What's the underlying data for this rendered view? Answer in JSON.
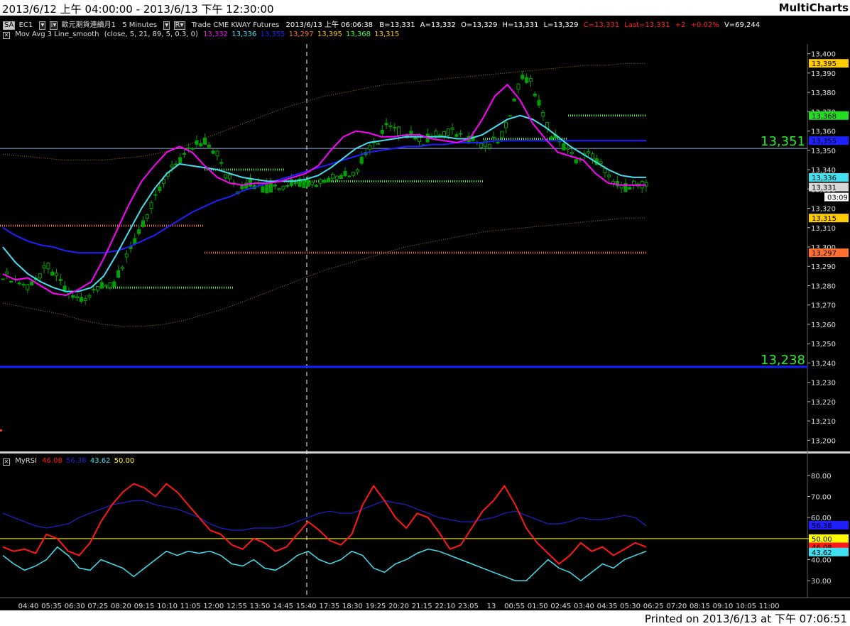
{
  "window": {
    "title": "2013/6/12 上午 04:00:00 - 2013/6/13 下午 12:30:00",
    "brand": "MultiCharts",
    "footer": "Printed on 2013/6/13 at 下午 07:06:51"
  },
  "toolbar": {
    "sa": "SA",
    "symbol": "EC1",
    "name": "歐元期貨連續月1",
    "interval": "5 Minutes",
    "r": "R",
    "desc": "Trade  CME  KWAY  Futures",
    "datetime": "2013/6/13  上午 06:06:38",
    "b": "B=13,331",
    "a": "A=13,332",
    "o": "O=13,329",
    "h": "H=13,331",
    "l": "L=13,329",
    "c": "C=13,331",
    "last": "Last=13,331",
    "chg": "+2",
    "pct": "+0.02%",
    "v": "V=69,244"
  },
  "ma_legend": {
    "name": "Mov Avg 3 Line_smooth",
    "params": "(close, 5, 21, 89, 5, 0.3, 0)",
    "values": [
      "13,332",
      "13,336",
      "13,355",
      "13,297",
      "13,395",
      "13,368",
      "13,315"
    ]
  },
  "rsi_legend": {
    "name": "MyRSI",
    "values": [
      "46.08",
      "56.38",
      "43.62",
      "50.00"
    ]
  },
  "colors": {
    "bg": "#000000",
    "candle": "#00a000",
    "ma_fast": "#ff00ff",
    "ma_mid": "#44e0f0",
    "ma_slow": "#2020ff",
    "level_green": "#44ff44",
    "level_orange": "#ff7030",
    "band": "#a07030",
    "rsi_red": "#ff1818",
    "rsi_blue": "#2020cc",
    "rsi_cyan": "#40e0f0",
    "rsi_mid": "#ffff00"
  },
  "chart_data": [
    {
      "type": "candlestick",
      "instrument": "EC1 歐元期貨連續月1",
      "interval": "5 Minutes",
      "ylim": [
        13195,
        13405
      ],
      "y_ticks": [
        13200,
        13210,
        13220,
        13230,
        13240,
        13250,
        13260,
        13270,
        13280,
        13290,
        13300,
        13310,
        13320,
        13330,
        13340,
        13350,
        13360,
        13370,
        13380,
        13390,
        13400
      ],
      "x_ticks": [
        "04:40",
        "05:35",
        "06:30",
        "07:25",
        "08:20",
        "09:15",
        "10:10",
        "11:05",
        "12:00",
        "12:55",
        "13:50",
        "14:45",
        "15:40",
        "17:35",
        "18:30",
        "19:25",
        "20:20",
        "21:15",
        "22:10",
        "23:05",
        "13",
        "00:55",
        "01:50",
        "02:45",
        "03:40",
        "04:35",
        "05:30",
        "06:25",
        "07:20",
        "08:15",
        "09:10",
        "10:05",
        "11:00"
      ],
      "session_divider": "15:40",
      "close_path": [
        [
          0,
          13286
        ],
        [
          6,
          13280
        ],
        [
          11,
          13290
        ],
        [
          16,
          13275
        ],
        [
          20,
          13272
        ],
        [
          23,
          13280
        ],
        [
          27,
          13282
        ],
        [
          31,
          13298
        ],
        [
          34,
          13312
        ],
        [
          37,
          13325
        ],
        [
          40,
          13338
        ],
        [
          43,
          13345
        ],
        [
          46,
          13352
        ],
        [
          49,
          13355
        ],
        [
          52,
          13348
        ],
        [
          54,
          13338
        ],
        [
          57,
          13330
        ],
        [
          60,
          13333
        ],
        [
          64,
          13330
        ],
        [
          68,
          13332
        ],
        [
          72,
          13333
        ],
        [
          76,
          13333
        ],
        [
          79,
          13336
        ],
        [
          83,
          13338
        ],
        [
          86,
          13340
        ],
        [
          88,
          13348
        ],
        [
          91,
          13355
        ],
        [
          93,
          13362
        ],
        [
          96,
          13360
        ],
        [
          99,
          13358
        ],
        [
          102,
          13355
        ],
        [
          105,
          13358
        ],
        [
          108,
          13360
        ],
        [
          111,
          13358
        ],
        [
          114,
          13355
        ],
        [
          117,
          13353
        ],
        [
          120,
          13355
        ],
        [
          122,
          13362
        ],
        [
          124,
          13378
        ],
        [
          126,
          13388
        ],
        [
          128,
          13385
        ],
        [
          131,
          13368
        ],
        [
          133,
          13358
        ],
        [
          136,
          13352
        ],
        [
          139,
          13345
        ],
        [
          142,
          13348
        ],
        [
          145,
          13343
        ],
        [
          147,
          13335
        ],
        [
          150,
          13330
        ],
        [
          153,
          13333
        ],
        [
          155,
          13332
        ],
        [
          156,
          13331
        ]
      ],
      "series": [
        {
          "name": "MA5",
          "values": [
            13286,
            13283,
            13284,
            13280,
            13276,
            13275,
            13278,
            13282,
            13294,
            13308,
            13322,
            13334,
            13342,
            13349,
            13352,
            13349,
            13342,
            13336,
            13333,
            13332,
            13333,
            13333,
            13334,
            13336,
            13338,
            13342,
            13350,
            13357,
            13360,
            13359,
            13357,
            13357,
            13358,
            13358,
            13356,
            13355,
            13354,
            13356,
            13366,
            13378,
            13384,
            13376,
            13364,
            13356,
            13349,
            13347,
            13345,
            13338,
            13333,
            13332,
            13332,
            13332
          ]
        },
        {
          "name": "MA21",
          "values": [
            13300,
            13292,
            13286,
            13282,
            13279,
            13277,
            13277,
            13279,
            13285,
            13296,
            13308,
            13320,
            13330,
            13338,
            13343,
            13342,
            13341,
            13340,
            13338,
            13336,
            13335,
            13334,
            13334,
            13334,
            13335,
            13337,
            13341,
            13346,
            13351,
            13354,
            13355,
            13356,
            13357,
            13357,
            13357,
            13357,
            13356,
            13356,
            13358,
            13362,
            13366,
            13368,
            13366,
            13362,
            13357,
            13352,
            13348,
            13344,
            13340,
            13337,
            13336,
            13336
          ]
        },
        {
          "name": "MA89",
          "values": [
            13310,
            13306,
            13303,
            13301,
            13300,
            13298,
            13297,
            13297,
            13297,
            13298,
            13300,
            13303,
            13306,
            13310,
            13314,
            13318,
            13321,
            13324,
            13326,
            13329,
            13331,
            13333,
            13335,
            13337,
            13339,
            13341,
            13343,
            13345,
            13347,
            13349,
            13350,
            13351,
            13352,
            13352,
            13353,
            13353,
            13354,
            13354,
            13354,
            13355,
            13355,
            13355,
            13355,
            13355,
            13355,
            13355,
            13355,
            13355,
            13355,
            13355,
            13355,
            13355
          ]
        },
        {
          "name": "Upper band",
          "values": [
            13348,
            13347,
            13346,
            13345,
            13345,
            13345,
            13346,
            13347,
            13349,
            13352,
            13356,
            13360,
            13364,
            13368,
            13372,
            13375,
            13378,
            13380,
            13382,
            13384,
            13385,
            13386,
            13387,
            13388,
            13389,
            13390,
            13391,
            13392,
            13393,
            13394,
            13394,
            13395,
            13395
          ]
        },
        {
          "name": "Lower band",
          "values": [
            13271,
            13269,
            13267,
            13265,
            13262,
            13260,
            13259,
            13259,
            13260,
            13262,
            13265,
            13268,
            13272,
            13276,
            13280,
            13284,
            13288,
            13291,
            13294,
            13297,
            13300,
            13302,
            13304,
            13306,
            13308,
            13309,
            13310,
            13311,
            13312,
            13313,
            13314,
            13315,
            13315
          ]
        }
      ],
      "levels": [
        {
          "value": 13311,
          "color": "green"
        },
        {
          "value": 13311,
          "color": "orange"
        },
        {
          "value": 13340,
          "color": "green"
        },
        {
          "value": 13279,
          "color": "green"
        },
        {
          "value": 13297,
          "color": "orange"
        },
        {
          "value": 13334,
          "color": "green"
        },
        {
          "value": 13368,
          "color": "green"
        },
        {
          "value": 13356,
          "color": "green"
        }
      ],
      "hlines": [
        {
          "value": 13351,
          "label": "13,351"
        },
        {
          "value": 13238,
          "label": "13,238"
        }
      ],
      "price_tags": [
        {
          "value": 13395,
          "label": "13,395",
          "color": "#ffcc00"
        },
        {
          "value": 13368,
          "label": "13,368",
          "color": "#22dd22"
        },
        {
          "value": 13355,
          "label": "13,355",
          "color": "#2020ff"
        },
        {
          "value": 13336,
          "label": "13,336",
          "color": "#44e0f0"
        },
        {
          "value": 13331,
          "label": "13,331",
          "color": "#d8d8d8"
        },
        {
          "value": 13315,
          "label": "13,315",
          "color": "#ffcc00"
        },
        {
          "value": 13297,
          "label": "13,297",
          "color": "#ff7030"
        }
      ],
      "time_tag": "03:09"
    },
    {
      "type": "line",
      "title": "MyRSI",
      "ylim": [
        22,
        88
      ],
      "y_ticks": [
        30,
        40,
        50,
        60,
        70,
        80
      ],
      "y_tick_labels": [
        "30.00",
        "40.00",
        "50.00",
        "60.00",
        "70.00",
        "80.00"
      ],
      "series": [
        {
          "name": "RSI",
          "values": [
            46,
            44,
            45,
            43,
            52,
            50,
            44,
            42,
            48,
            58,
            66,
            72,
            76,
            74,
            70,
            76,
            72,
            66,
            60,
            54,
            52,
            47,
            45,
            50,
            48,
            44,
            46,
            52,
            58,
            54,
            49,
            47,
            52,
            66,
            75,
            68,
            60,
            55,
            62,
            60,
            53,
            45,
            47,
            55,
            63,
            68,
            75,
            66,
            55,
            48,
            43,
            38,
            42,
            48,
            44,
            46,
            42,
            45,
            48,
            46
          ]
        },
        {
          "name": "RSI avg",
          "values": [
            62,
            60,
            58,
            56,
            55,
            56,
            57,
            60,
            62,
            64,
            66,
            67,
            68,
            68,
            66,
            65,
            64,
            62,
            60,
            57,
            55,
            54,
            54,
            55,
            55,
            55,
            56,
            58,
            60,
            62,
            63,
            62,
            62,
            64,
            66,
            68,
            67,
            66,
            64,
            62,
            60,
            59,
            58,
            58,
            59,
            60,
            62,
            63,
            61,
            59,
            57,
            57,
            58,
            60,
            59,
            59,
            60,
            61,
            60,
            56
          ]
        },
        {
          "name": "RSI lower",
          "values": [
            42,
            38,
            35,
            37,
            40,
            46,
            42,
            36,
            35,
            40,
            38,
            36,
            32,
            36,
            40,
            44,
            42,
            44,
            43,
            44,
            42,
            38,
            37,
            40,
            36,
            35,
            38,
            42,
            44,
            40,
            38,
            40,
            44,
            42,
            36,
            34,
            38,
            40,
            43,
            45,
            44,
            42,
            40,
            38,
            36,
            34,
            32,
            30,
            30,
            35,
            40,
            36,
            34,
            30,
            34,
            38,
            36,
            40,
            42,
            44
          ]
        },
        {
          "name": "Mid",
          "values": [
            50
          ]
        }
      ],
      "tags": [
        {
          "value": 56.38,
          "label": "56.38",
          "color": "#2020ff"
        },
        {
          "value": 50.0,
          "label": "50.00",
          "color": "#ffff00"
        },
        {
          "value": 46.08,
          "label": "46.08",
          "color": "#ff1818"
        },
        {
          "value": 43.62,
          "label": "43.62",
          "color": "#40e0f0"
        }
      ]
    }
  ]
}
